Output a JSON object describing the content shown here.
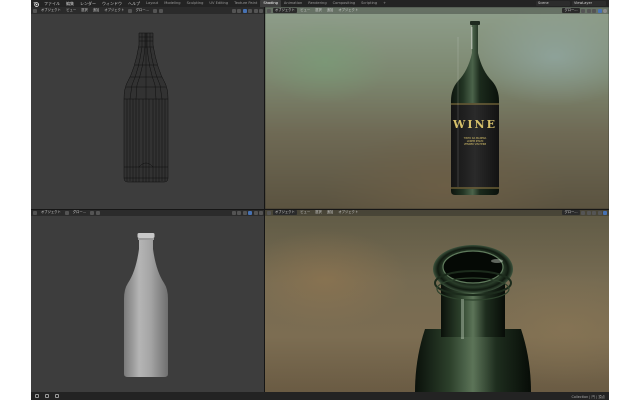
{
  "menu": {
    "file": "ファイル",
    "edit": "編集",
    "render": "レンダー",
    "window": "ウィンドウ",
    "help": "ヘルプ"
  },
  "workspaces": [
    "Layout",
    "Modeling",
    "Sculpting",
    "UV Editing",
    "Texture Paint",
    "Shading",
    "Animation",
    "Rendering",
    "Compositing",
    "Scripting"
  ],
  "active_workspace": "Shading",
  "scene": {
    "scene_name": "Scene",
    "view_layer": "ViewLayer"
  },
  "viewport_header": {
    "mode": "オブジェクト",
    "view": "ビュー",
    "select": "選択",
    "add": "追加",
    "object": "オブジェクト",
    "transform_orientation": "グロー..."
  },
  "label": {
    "brand": "WINE",
    "line1": "TINTO DA MADERA",
    "line2": "LOREM IPSUM",
    "line3": "VENDER VIN HERB"
  },
  "statusbar": {
    "info": "Collection | 円 | 頂点"
  },
  "colors": {
    "ui_dark": "#1d1d1d",
    "viewport_grey": "#3d3d3d",
    "accent_blue": "#4772b3",
    "label_gold": "#d6c06a",
    "glass_green": "#1b2a1c"
  }
}
